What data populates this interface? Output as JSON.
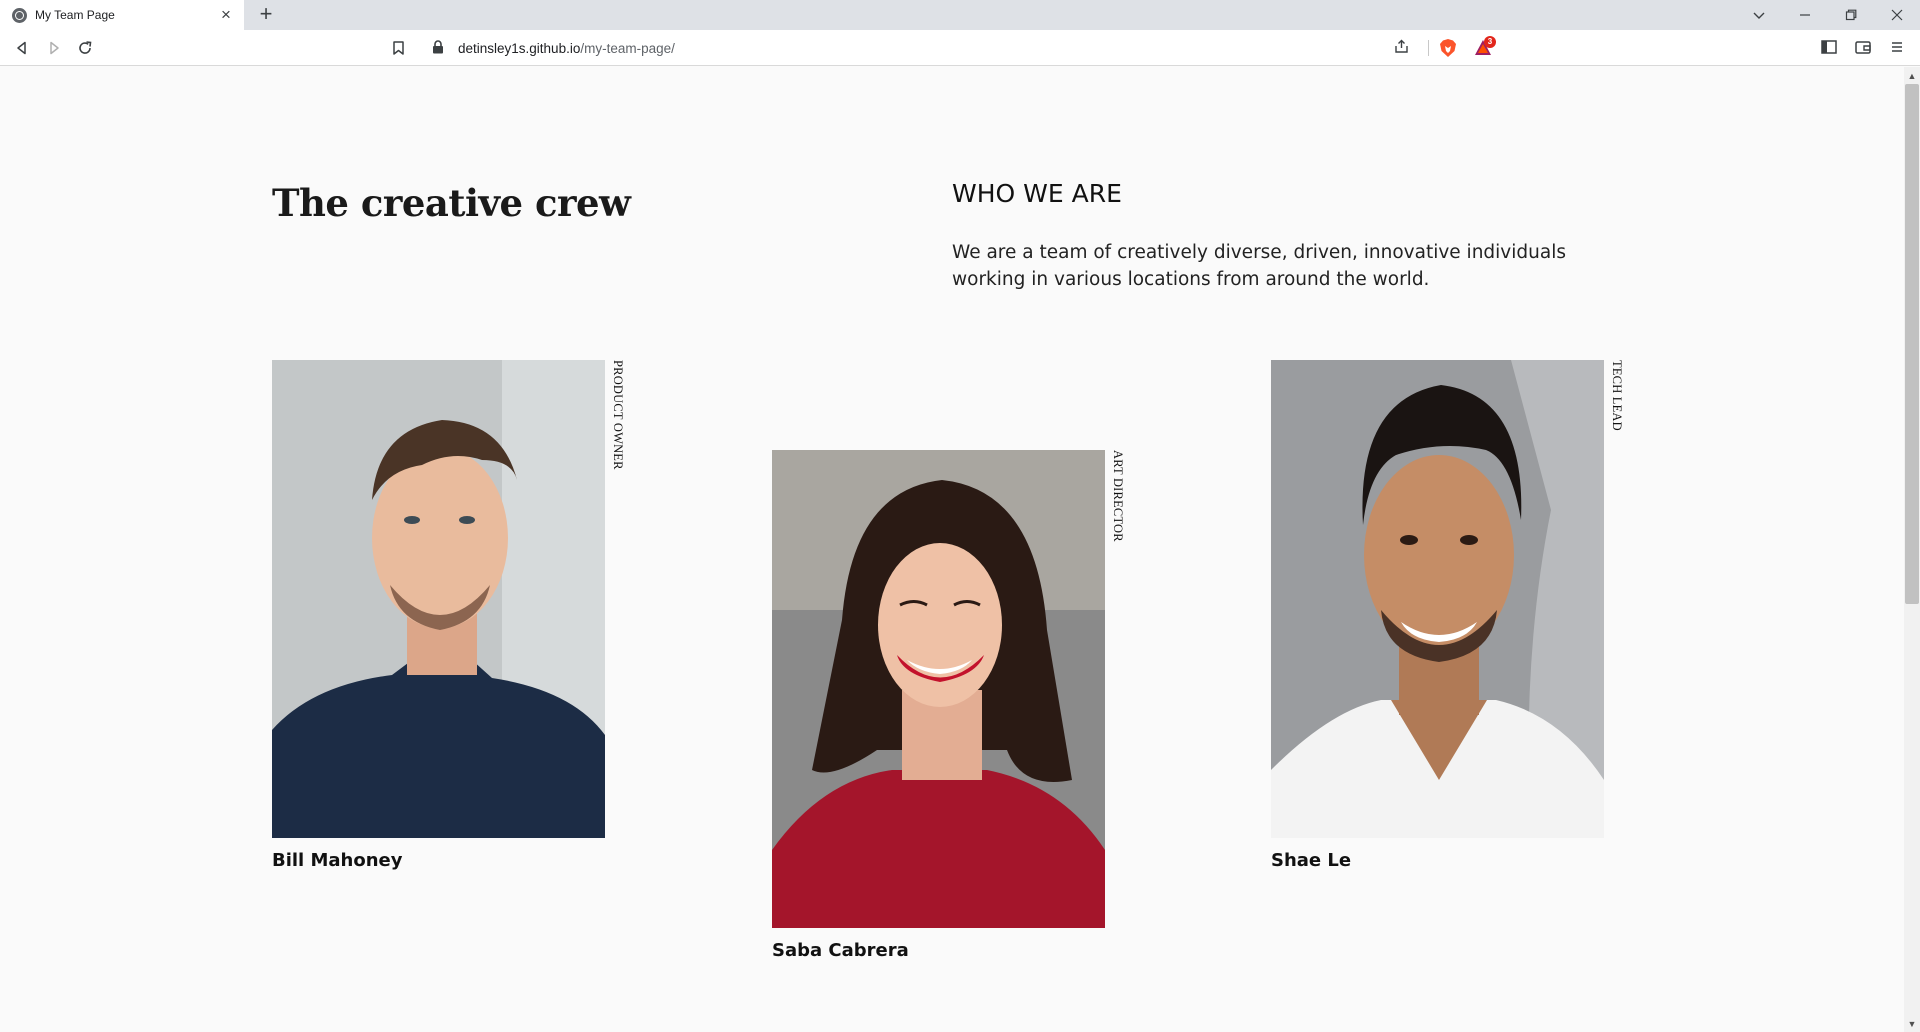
{
  "browser": {
    "tab_title": "My Team Page",
    "url_host": "detinsley1s.github.io",
    "url_path": "/my-team-page/",
    "rewards_count": "3"
  },
  "icons": {
    "tab_favicon": "globe-icon",
    "close": "close-icon",
    "new_tab": "plus-icon",
    "back": "back-arrow-icon",
    "forward": "forward-arrow-icon",
    "reload": "reload-icon",
    "bookmark": "bookmark-icon",
    "lock": "lock-icon",
    "share": "share-icon",
    "brave_shields": "brave-lion-icon",
    "rewards": "brave-rewards-icon",
    "sidebar": "sidebar-icon",
    "wallet": "wallet-icon",
    "menu": "menu-icon"
  },
  "page": {
    "headline": "The creative crew",
    "who_heading": "WHO WE ARE",
    "who_text": "We are a team of creatively diverse, driven, innovative individuals working in various locations from around the world.",
    "members": [
      {
        "name": "Bill Mahoney",
        "role": "PRODUCT OWNER"
      },
      {
        "name": "Saba Cabrera",
        "role": "ART DIRECTOR"
      },
      {
        "name": "Shae Le",
        "role": "TECH LEAD"
      }
    ]
  },
  "colors": {
    "page_bg": "#fafafa",
    "tabbar_bg": "#dee1e6",
    "text": "#111111"
  }
}
